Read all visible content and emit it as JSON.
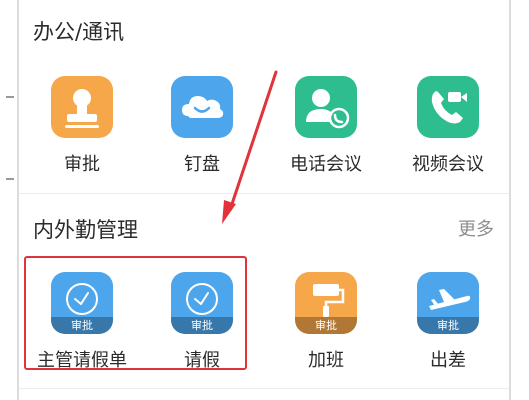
{
  "colors": {
    "orange": "#f6a74a",
    "blue": "#4da6ec",
    "green": "#2dbd8e",
    "annotation_red": "#e2333b"
  },
  "sections": [
    {
      "title": "办公/通讯",
      "more": "",
      "apps": [
        {
          "label": "审批",
          "icon": "approval-stamp-icon",
          "color": "#f6a74a"
        },
        {
          "label": "钉盘",
          "icon": "cloud-drive-icon",
          "color": "#4da6ec"
        },
        {
          "label": "电话会议",
          "icon": "phone-conference-icon",
          "color": "#2dbd8e"
        },
        {
          "label": "视频会议",
          "icon": "video-call-icon",
          "color": "#2dbd8e"
        }
      ]
    },
    {
      "title": "内外勤管理",
      "more": "更多",
      "apps": [
        {
          "label": "主管请假单",
          "icon": "clock-icon",
          "color": "#4da6ec",
          "tag": "审批"
        },
        {
          "label": "请假",
          "icon": "clock-icon",
          "color": "#4da6ec",
          "tag": "审批"
        },
        {
          "label": "加班",
          "icon": "paint-roller-icon",
          "color": "#f6a74a",
          "tag": "审批"
        },
        {
          "label": "出差",
          "icon": "airplane-icon",
          "color": "#4da6ec",
          "tag": "审批"
        }
      ]
    }
  ]
}
